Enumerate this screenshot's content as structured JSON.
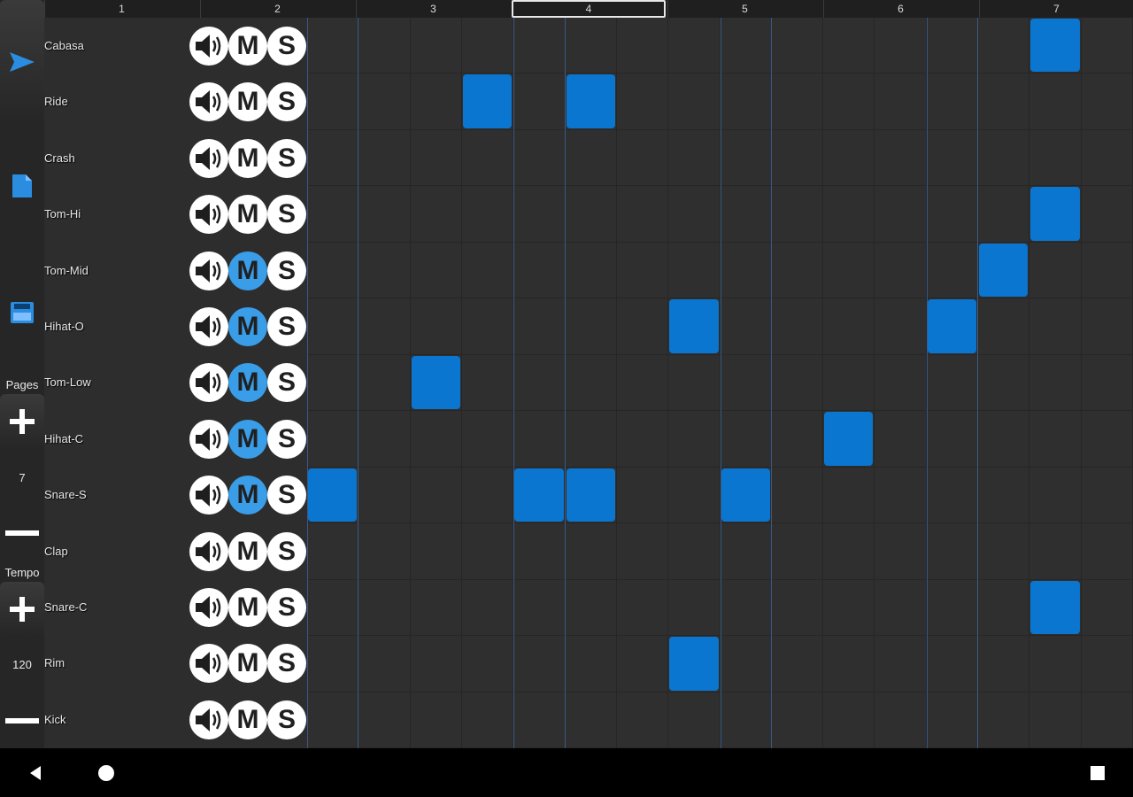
{
  "pages_header": [
    "1",
    "2",
    "3",
    "4",
    "5",
    "6",
    "7"
  ],
  "active_page": 4,
  "sidebar": {
    "play_icon": "play-icon",
    "file_icon": "file-icon",
    "save_icon": "save-icon",
    "pages_label": "Pages",
    "pages_value": "7",
    "tempo_label": "Tempo",
    "tempo_value": "120"
  },
  "controls": {
    "mute_label": "M",
    "solo_label": "S"
  },
  "tracks": [
    {
      "name": "Cabasa",
      "muted": false
    },
    {
      "name": "Ride",
      "muted": false
    },
    {
      "name": "Crash",
      "muted": false
    },
    {
      "name": "Tom-Hi",
      "muted": false
    },
    {
      "name": "Tom-Mid",
      "muted": true
    },
    {
      "name": "Hihat-O",
      "muted": true
    },
    {
      "name": "Tom-Low",
      "muted": true
    },
    {
      "name": "Hihat-C",
      "muted": true
    },
    {
      "name": "Snare-S",
      "muted": true
    },
    {
      "name": "Clap",
      "muted": false
    },
    {
      "name": "Snare-C",
      "muted": false
    },
    {
      "name": "Rim",
      "muted": false
    },
    {
      "name": "Kick",
      "muted": false
    }
  ],
  "grid": {
    "steps": 16,
    "active": [
      [
        0,
        14
      ],
      [
        1,
        3
      ],
      [
        1,
        5
      ],
      [
        3,
        14
      ],
      [
        4,
        13
      ],
      [
        5,
        7
      ],
      [
        5,
        12
      ],
      [
        6,
        2
      ],
      [
        7,
        10
      ],
      [
        8,
        0
      ],
      [
        8,
        4
      ],
      [
        8,
        5
      ],
      [
        8,
        8
      ],
      [
        10,
        14
      ],
      [
        11,
        7
      ]
    ],
    "beat_columns": [
      0,
      4,
      8,
      12
    ]
  },
  "colors": {
    "accent": "#0a76d0",
    "mute_on": "#3a9de8",
    "background": "#2d2d2d"
  },
  "navbar": [
    "back-icon",
    "home-icon",
    "recents-icon"
  ]
}
